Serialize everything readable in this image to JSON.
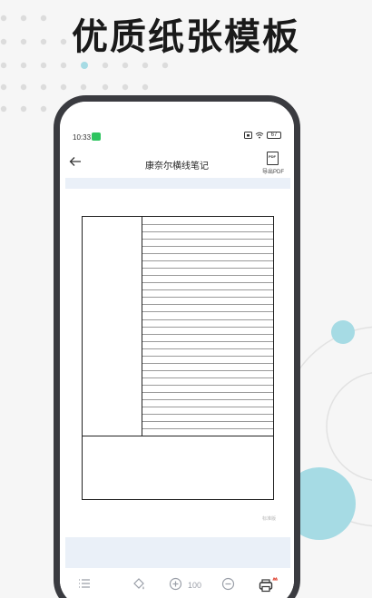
{
  "promo": {
    "title": "优质纸张模板"
  },
  "status_bar": {
    "time": "10:33",
    "battery": "67"
  },
  "header": {
    "title": "康奈尔横线笔记",
    "export_icon_text": "PDF",
    "export_label": "导出PDF"
  },
  "paper": {
    "template": "cornell-lined",
    "ruled_lines": 29,
    "page_mark": "标准版"
  },
  "toolbar": {
    "zoom": "100",
    "icons": [
      "list-icon",
      "fill-icon",
      "zoom-in-icon",
      "zoom-out-icon",
      "print-icon"
    ]
  },
  "colors": {
    "phone_frame": "#3a3b40",
    "band": "#eaf0f8",
    "accent_teal": "#a6dbe4",
    "title": "#1a1a1a"
  }
}
